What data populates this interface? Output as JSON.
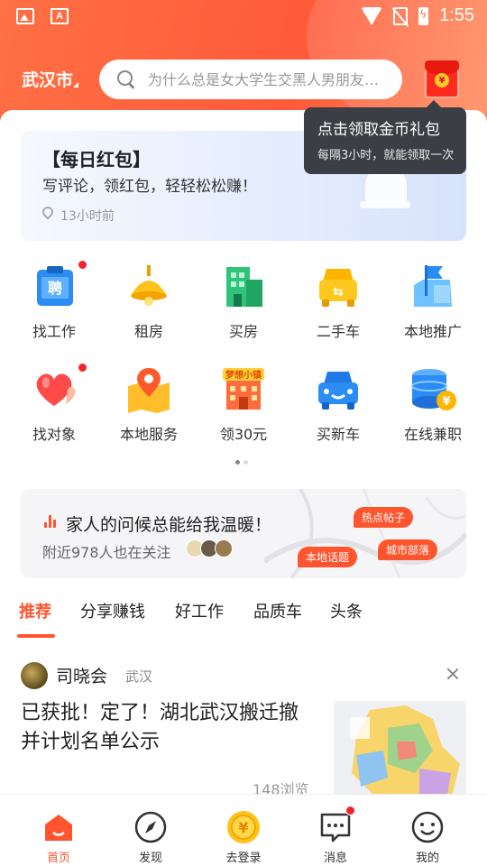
{
  "status_bar": {
    "time": "1:55",
    "icons": [
      "gallery-icon",
      "font-icon",
      "wifi-icon",
      "no-sim-icon",
      "battery-charging-icon"
    ]
  },
  "header": {
    "city": "武汉市",
    "search_placeholder": "为什么总是女大学生交黑人男朋友，...",
    "redpacket_icon": "red-envelope-icon"
  },
  "tooltip": {
    "title": "点击领取金币礼包",
    "subtitle": "每隔3小时，就能领取一次"
  },
  "daily_card": {
    "title": "【每日红包】",
    "subtitle": "写评论，领红包，轻轻松松赚！",
    "time": "13小时前"
  },
  "grid": {
    "items": [
      {
        "label": "找工作",
        "icon": "job-icon",
        "badge": true
      },
      {
        "label": "租房",
        "icon": "lamp-icon",
        "badge": false
      },
      {
        "label": "买房",
        "icon": "building-icon",
        "badge": false
      },
      {
        "label": "二手车",
        "icon": "used-car-icon",
        "badge": false
      },
      {
        "label": "本地推广",
        "icon": "flag-icon",
        "badge": false
      },
      {
        "label": "找对象",
        "icon": "heart-balloon-icon",
        "badge": true
      },
      {
        "label": "本地服务",
        "icon": "map-pin-icon",
        "badge": false
      },
      {
        "label": "领30元",
        "icon": "shop-icon",
        "badge": false,
        "icon_caption": "梦想小镇"
      },
      {
        "label": "买新车",
        "icon": "new-car-icon",
        "badge": false
      },
      {
        "label": "在线兼职",
        "icon": "coin-stack-icon",
        "badge": false
      }
    ]
  },
  "family_card": {
    "title": "家人的问候总能给我温暖！",
    "subtitle": "附近978人也在关注",
    "tags": [
      "热点帖子",
      "本地话题",
      "城市部落"
    ]
  },
  "tabs": [
    "推荐",
    "分享赚钱",
    "好工作",
    "品质车",
    "头条"
  ],
  "feed": {
    "author": "司晓会",
    "location": "武汉",
    "headline": "已获批！定了！湖北武汉搬迁撤并计划名单公示",
    "views": "148浏览"
  },
  "bottom_nav": [
    {
      "label": "首页",
      "icon": "home-icon",
      "active": true
    },
    {
      "label": "发现",
      "icon": "compass-icon",
      "active": false
    },
    {
      "label": "去登录",
      "icon": "gold-coin-icon",
      "active": false
    },
    {
      "label": "消息",
      "icon": "message-icon",
      "active": false,
      "badge": true
    },
    {
      "label": "我的",
      "icon": "smiley-icon",
      "active": false
    }
  ],
  "colors": {
    "brand": "#ff552e",
    "header": "#ff6a40"
  }
}
